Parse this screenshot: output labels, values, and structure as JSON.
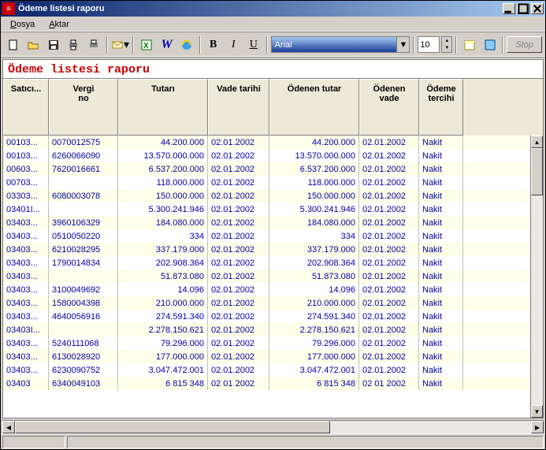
{
  "window": {
    "title": "Ödeme listesi raporu"
  },
  "menu": {
    "file": "Dosya",
    "export": "Aktar"
  },
  "toolbar": {
    "font_name": "Arial",
    "font_size": "10",
    "stop": "Stop"
  },
  "report": {
    "title": "Ödeme listesi raporu"
  },
  "columns": {
    "c0": "Satıcı...",
    "c1": "Vergi\nno",
    "c2": "Tutarı",
    "c3": "Vade tarihi",
    "c4": "Ödenen tutar",
    "c5": "Ödenen\nvade",
    "c6": "Ödeme\ntercihi"
  },
  "rows": [
    {
      "c0": "00103...",
      "c1": "0070012575",
      "c2": "44.200.000",
      "c3": "02.01.2002",
      "c4": "44.200.000",
      "c5": "02.01.2002",
      "c6": "Nakit"
    },
    {
      "c0": "00103...",
      "c1": "6260066090",
      "c2": "13.570.000.000",
      "c3": "02.01.2002",
      "c4": "13.570.000.000",
      "c5": "02.01.2002",
      "c6": "Nakit"
    },
    {
      "c0": "00603...",
      "c1": "7620016661",
      "c2": "6.537.200.000",
      "c3": "02.01.2002",
      "c4": "6.537.200.000",
      "c5": "02.01.2002",
      "c6": "Nakit"
    },
    {
      "c0": "00703...",
      "c1": "",
      "c2": "118.000.000",
      "c3": "02.01.2002",
      "c4": "118.000.000",
      "c5": "02.01.2002",
      "c6": "Nakit"
    },
    {
      "c0": "03303...",
      "c1": "6080003078",
      "c2": "150.000.000",
      "c3": "02.01.2002",
      "c4": "150.000.000",
      "c5": "02.01.2002",
      "c6": "Nakit"
    },
    {
      "c0": "03401I...",
      "c1": "",
      "c2": "5.300.241.946",
      "c3": "02.01.2002",
      "c4": "5.300.241.946",
      "c5": "02.01.2002",
      "c6": "Nakit"
    },
    {
      "c0": "03403...",
      "c1": "3960106329",
      "c2": "184.080.000",
      "c3": "02.01.2002",
      "c4": "184.080.000",
      "c5": "02.01.2002",
      "c6": "Nakit"
    },
    {
      "c0": "03403...",
      "c1": "0510050220",
      "c2": "334",
      "c3": "02.01.2002",
      "c4": "334",
      "c5": "02.01.2002",
      "c6": "Nakit"
    },
    {
      "c0": "03403...",
      "c1": "6210028295",
      "c2": "337.179.000",
      "c3": "02.01.2002",
      "c4": "337.179.000",
      "c5": "02.01.2002",
      "c6": "Nakit"
    },
    {
      "c0": "03403...",
      "c1": "1790014834",
      "c2": "202.908.364",
      "c3": "02.01.2002",
      "c4": "202.908.364",
      "c5": "02.01.2002",
      "c6": "Nakit"
    },
    {
      "c0": "03403...",
      "c1": "",
      "c2": "51.873.080",
      "c3": "02.01.2002",
      "c4": "51.873.080",
      "c5": "02.01.2002",
      "c6": "Nakit"
    },
    {
      "c0": "03403...",
      "c1": "3100049692",
      "c2": "14.096",
      "c3": "02.01.2002",
      "c4": "14.096",
      "c5": "02.01.2002",
      "c6": "Nakit"
    },
    {
      "c0": "03403...",
      "c1": "1580004398",
      "c2": "210.000.000",
      "c3": "02.01.2002",
      "c4": "210.000.000",
      "c5": "02.01.2002",
      "c6": "Nakit"
    },
    {
      "c0": "03403...",
      "c1": "4640056916",
      "c2": "274.591.340",
      "c3": "02.01.2002",
      "c4": "274.591.340",
      "c5": "02.01.2002",
      "c6": "Nakit"
    },
    {
      "c0": "03403I...",
      "c1": "",
      "c2": "2.278.150.621",
      "c3": "02.01.2002",
      "c4": "2.278.150.621",
      "c5": "02.01.2002",
      "c6": "Nakit"
    },
    {
      "c0": "03403...",
      "c1": "5240111068",
      "c2": "79.296.000",
      "c3": "02.01.2002",
      "c4": "79.296.000",
      "c5": "02.01.2002",
      "c6": "Nakit"
    },
    {
      "c0": "03403...",
      "c1": "6130028920",
      "c2": "177.000.000",
      "c3": "02.01.2002",
      "c4": "177.000.000",
      "c5": "02.01.2002",
      "c6": "Nakit"
    },
    {
      "c0": "03403...",
      "c1": "6230090752",
      "c2": "3.047.472.001",
      "c3": "02.01.2002",
      "c4": "3.047.472.001",
      "c5": "02.01.2002",
      "c6": "Nakit"
    },
    {
      "c0": "03403",
      "c1": "6340049103",
      "c2": "6 815 348",
      "c3": "02 01 2002",
      "c4": "6 815 348",
      "c5": "02 01 2002",
      "c6": "Nakit"
    }
  ]
}
